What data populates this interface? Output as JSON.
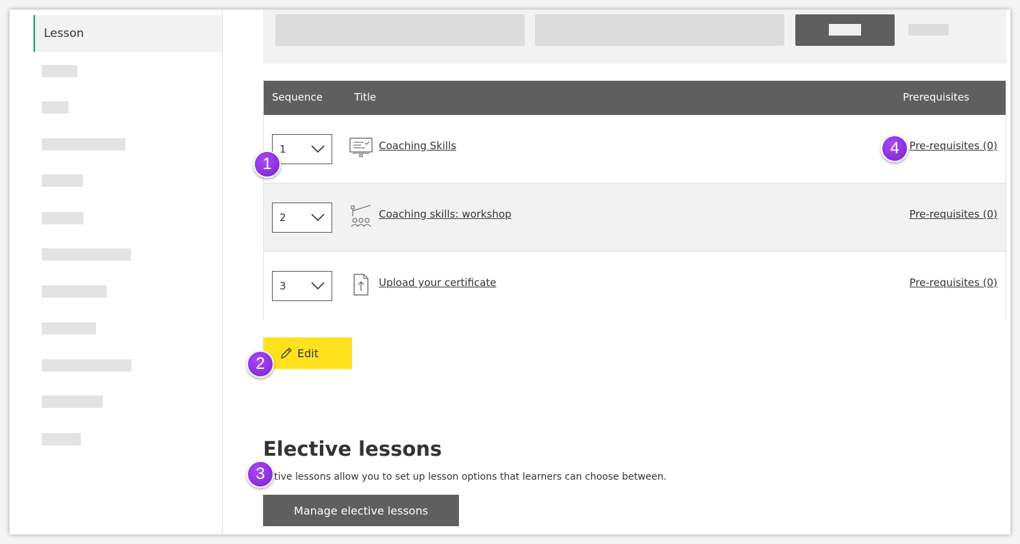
{
  "sidebar": {
    "active_item": "Lesson"
  },
  "table": {
    "headers": {
      "sequence": "Sequence",
      "title": "Title",
      "prerequisites": "Prerequisites"
    },
    "rows": [
      {
        "sequence": "1",
        "title": "Coaching Skills",
        "icon": "presentation-screen-icon",
        "prerequisites": "Pre-requisites (0)"
      },
      {
        "sequence": "2",
        "title": "Coaching skills: workshop",
        "icon": "workshop-icon",
        "prerequisites": "Pre-requisites (0)"
      },
      {
        "sequence": "3",
        "title": "Upload your certificate",
        "icon": "file-upload-icon",
        "prerequisites": "Pre-requisites (0)"
      }
    ]
  },
  "edit_label": "Edit",
  "elective": {
    "heading": "Elective lessons",
    "description": "ective lessons allow you to set up lesson options that learners can choose between.",
    "button": "Manage elective lessons"
  },
  "badges": [
    "1",
    "2",
    "3",
    "4"
  ],
  "colors": {
    "accent": "#2e8b6b",
    "edit": "#ffe21c",
    "dark": "#5f5f5f",
    "badge": "#8e2de2"
  }
}
